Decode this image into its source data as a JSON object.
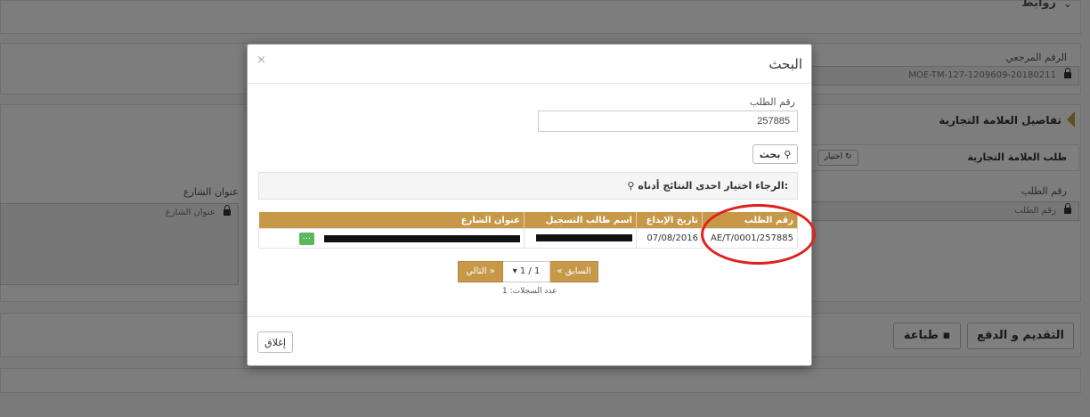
{
  "background": {
    "links_header": "روابط",
    "reference_label": "الرقم المرجعي",
    "reference_value": "MOE-TM-127-1209609-20180211",
    "trademark_details_title": "تفاصيل العلامة التجارية",
    "trademark_request_label": "طلب العلامة التجارية",
    "select_button": "اختيار",
    "request_number_label": "رقم الطلب",
    "request_number_placeholder": "رقم الطلب",
    "street_address_label": "عنوان الشارع",
    "street_address_placeholder": "عنوان الشارع",
    "submit_pay_button": "التقديم و الدفع",
    "print_button": "طباعة"
  },
  "modal": {
    "title": "البحث",
    "close_symbol": "×",
    "request_number_label": "رقم الطلب",
    "request_number_value": "257885",
    "search_button": "بحث",
    "notice_text": "الرجاء اختيار احدى النتائج أدناه:",
    "table": {
      "headers": [
        "رقم الطلب",
        "تاريخ الإيداع",
        "اسم طالب التسجيل",
        "عنوان الشارع"
      ],
      "rows": [
        {
          "request_number": "AE/T/0001/257885",
          "filing_date": "07/08/2016",
          "applicant": "",
          "address": ""
        }
      ],
      "row_action": "..."
    },
    "pager": {
      "previous": "« السابق",
      "page": "1 / 1",
      "next": "التالي »",
      "record_count": "عدد السجلات: 1"
    },
    "close_button": "إغلاق"
  },
  "colors": {
    "accent": "#c89849",
    "annotation_circle": "#e0201d",
    "row_action_green": "#5cb85c"
  }
}
